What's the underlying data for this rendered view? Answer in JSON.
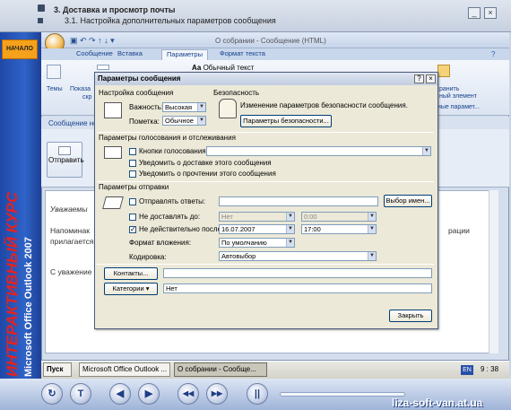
{
  "course": {
    "title": "3. Доставка и просмотр почты",
    "subtitle": "3.1. Настройка дополнительных параметров сообщения",
    "start_label": "НАЧАЛО",
    "vertical_title": "ИНТЕРАКТИВНЫЙ КУРС",
    "vertical_subtitle": "Microsoft Office Outlook 2007",
    "brand": "liza-soft-van.at.ua"
  },
  "outlook": {
    "window_title": "О собрании - Сообщение (HTML)",
    "tabs": [
      "Сообщение",
      "Вставка",
      "Параметры",
      "Формат текста"
    ],
    "active_tab": "Параметры",
    "ribbon": {
      "themes_label": "Темы",
      "show_label": "Показа",
      "show_label2": "скр",
      "font_style_label": "Обычный текст",
      "right_label1": "ранить",
      "right_label2": "ный элемент",
      "right_group": "ные парамет..."
    },
    "toolbar_label": "Сообщение не",
    "send_label": "Отправить",
    "body_lines": [
      "Уважаемы",
      "Напоминак",
      "прилагается",
      "рации",
      "С уважение"
    ]
  },
  "dialog": {
    "title": "Параметры сообщения",
    "help_btn": "?",
    "close_btn": "×",
    "settings_section": "Настройка сообщения",
    "importance_label": "Важность:",
    "importance_value": "Высокая",
    "sensitivity_label": "Пометка:",
    "sensitivity_value": "Обычное",
    "security_section": "Безопасность",
    "security_text": "Изменение параметров безопасности сообщения.",
    "security_button": "Параметры безопасности...",
    "voting_section": "Параметры голосования и отслеживания",
    "voting_buttons_label": "Кнопки голосования:",
    "voting_buttons_value": "",
    "delivery_receipt": "Уведомить о доставке этого сообщения",
    "read_receipt": "Уведомить о прочтении этого сообщения",
    "delivery_section": "Параметры отправки",
    "replies_to_label": "Отправлять ответы:",
    "replies_to_value": "",
    "select_names_button": "Выбор имен...",
    "dont_deliver_label": "Не доставлять до:",
    "dont_deliver_date": "Нет",
    "dont_deliver_time": "0:00",
    "expires_label": "Не действительно после:",
    "expires_date": "16.07.2007",
    "expires_time": "17:00",
    "attachment_format_label": "Формат вложения:",
    "attachment_format_value": "По умолчанию",
    "encoding_label": "Кодировка:",
    "encoding_value": "Автовыбор",
    "contacts_button": "Контакты...",
    "contacts_value": "",
    "categories_button": "Категории",
    "categories_value": "Нет",
    "close_button": "Закрыть",
    "checks": {
      "voting": false,
      "delivery": false,
      "read": false,
      "replies": false,
      "dont_deliver": false,
      "expires": true
    }
  },
  "taskbar": {
    "start": "Пуск",
    "items": [
      "Microsoft Office Outlook ...",
      "О собрании - Сообще..."
    ],
    "lang": "EN",
    "time": "9 : 38"
  },
  "player": {
    "buttons": [
      "↻",
      "T",
      "◀",
      "▶",
      "◀◀",
      "▶▶",
      "||"
    ]
  }
}
